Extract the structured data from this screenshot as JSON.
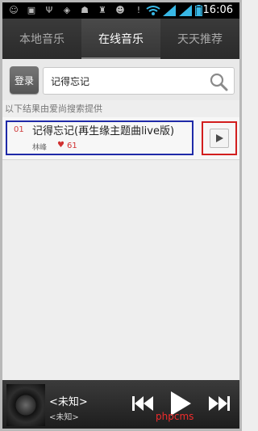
{
  "status_bar": {
    "time": "16:06",
    "icons": [
      "android-icon",
      "tray-icon",
      "usb-icon",
      "notification-icon",
      "cat-icon",
      "wifi-icon",
      "signal-icon",
      "signal-icon",
      "battery-icon"
    ]
  },
  "tabs": [
    {
      "label": "本地音乐",
      "active": false
    },
    {
      "label": "在线音乐",
      "active": true
    },
    {
      "label": "天天推荐",
      "active": false
    }
  ],
  "search": {
    "login_label": "登录",
    "query": "记得忘记",
    "hint": "以下结果由爱尚搜索提供"
  },
  "results": [
    {
      "index": "01",
      "title": "记得忘记(再生缘主题曲live版)",
      "artist": "林峰",
      "count": "61"
    }
  ],
  "player": {
    "title": "<未知>",
    "artist": "<未知>"
  },
  "watermark": "phpcms",
  "colors": {
    "highlight_blue": "#1f2aa8",
    "highlight_red": "#d21e1e",
    "heart_red": "#d03030"
  }
}
